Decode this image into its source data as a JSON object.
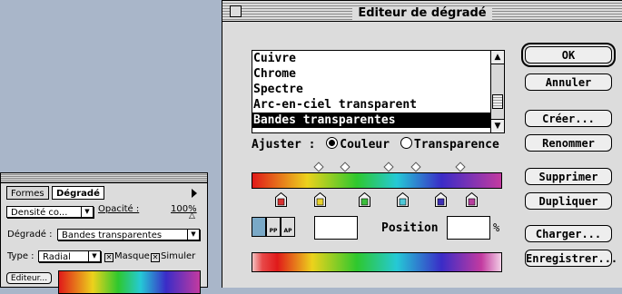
{
  "dialog": {
    "title": "Editeur de dégradé",
    "list_items": [
      "Cuivre",
      "Chrome",
      "Spectre",
      "Arc-en-ciel transparent",
      "Bandes transparentes"
    ],
    "selected_item": "Bandes transparentes",
    "adjust_label": "Ajuster :",
    "radio_color": "Couleur",
    "radio_transparency": "Transparence",
    "radio_selected": "Couleur",
    "position_label": "Position :",
    "position_value": "",
    "percent_sign": "%",
    "stop_type_buttons": [
      "stop-selected",
      "PP",
      "AP"
    ],
    "color_stops": [
      "#d83030",
      "#e8d22a",
      "#3cbe3c",
      "#4ec9d8",
      "#3d2eb5",
      "#b83e9e"
    ],
    "buttons": {
      "ok": "OK",
      "cancel": "Annuler",
      "create": "Créer...",
      "rename": "Renommer",
      "delete": "Supprimer",
      "duplicate": "Dupliquer",
      "load": "Charger...",
      "save": "Enregistrer..."
    }
  },
  "palette": {
    "tabs": [
      "Formes",
      "Dégradé"
    ],
    "active_tab": "Dégradé",
    "mode_value": "Densité co...",
    "opacity_label": "Opacité :",
    "opacity_value": "100%",
    "gradient_label": "Dégradé :",
    "gradient_value": "Bandes transparentes",
    "type_label": "Type :",
    "type_value": "Radial",
    "mask_label": "Masque",
    "mask_checked": true,
    "dither_label": "Simuler",
    "dither_checked": true,
    "edit_button": "Editeur..."
  },
  "colors": {
    "desktop": "#a9b6c9",
    "dialog_bg": "#dcdcdc",
    "selection": "#000000"
  }
}
